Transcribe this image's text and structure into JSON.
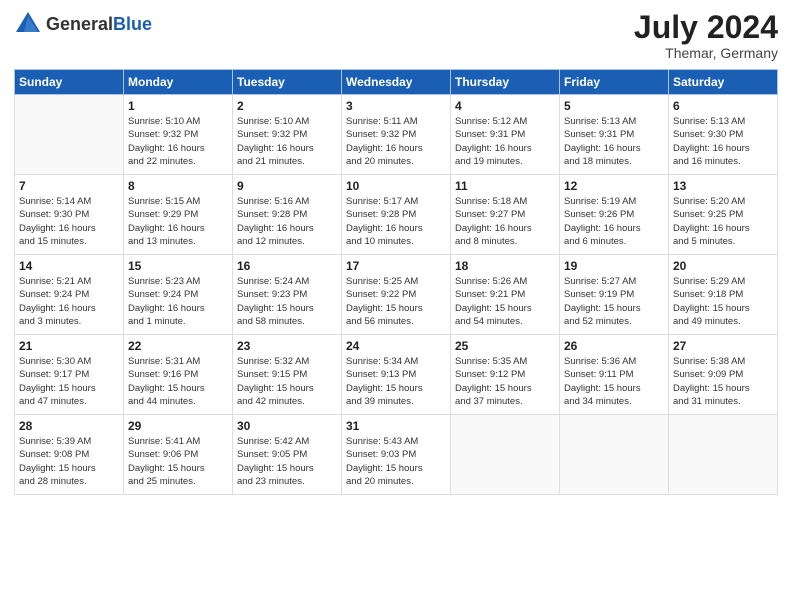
{
  "logo": {
    "general": "General",
    "blue": "Blue"
  },
  "title": {
    "month_year": "July 2024",
    "location": "Themar, Germany"
  },
  "header_days": [
    "Sunday",
    "Monday",
    "Tuesday",
    "Wednesday",
    "Thursday",
    "Friday",
    "Saturday"
  ],
  "weeks": [
    [
      {
        "day": "",
        "info": ""
      },
      {
        "day": "1",
        "info": "Sunrise: 5:10 AM\nSunset: 9:32 PM\nDaylight: 16 hours\nand 22 minutes."
      },
      {
        "day": "2",
        "info": "Sunrise: 5:10 AM\nSunset: 9:32 PM\nDaylight: 16 hours\nand 21 minutes."
      },
      {
        "day": "3",
        "info": "Sunrise: 5:11 AM\nSunset: 9:32 PM\nDaylight: 16 hours\nand 20 minutes."
      },
      {
        "day": "4",
        "info": "Sunrise: 5:12 AM\nSunset: 9:31 PM\nDaylight: 16 hours\nand 19 minutes."
      },
      {
        "day": "5",
        "info": "Sunrise: 5:13 AM\nSunset: 9:31 PM\nDaylight: 16 hours\nand 18 minutes."
      },
      {
        "day": "6",
        "info": "Sunrise: 5:13 AM\nSunset: 9:30 PM\nDaylight: 16 hours\nand 16 minutes."
      }
    ],
    [
      {
        "day": "7",
        "info": "Sunrise: 5:14 AM\nSunset: 9:30 PM\nDaylight: 16 hours\nand 15 minutes."
      },
      {
        "day": "8",
        "info": "Sunrise: 5:15 AM\nSunset: 9:29 PM\nDaylight: 16 hours\nand 13 minutes."
      },
      {
        "day": "9",
        "info": "Sunrise: 5:16 AM\nSunset: 9:28 PM\nDaylight: 16 hours\nand 12 minutes."
      },
      {
        "day": "10",
        "info": "Sunrise: 5:17 AM\nSunset: 9:28 PM\nDaylight: 16 hours\nand 10 minutes."
      },
      {
        "day": "11",
        "info": "Sunrise: 5:18 AM\nSunset: 9:27 PM\nDaylight: 16 hours\nand 8 minutes."
      },
      {
        "day": "12",
        "info": "Sunrise: 5:19 AM\nSunset: 9:26 PM\nDaylight: 16 hours\nand 6 minutes."
      },
      {
        "day": "13",
        "info": "Sunrise: 5:20 AM\nSunset: 9:25 PM\nDaylight: 16 hours\nand 5 minutes."
      }
    ],
    [
      {
        "day": "14",
        "info": "Sunrise: 5:21 AM\nSunset: 9:24 PM\nDaylight: 16 hours\nand 3 minutes."
      },
      {
        "day": "15",
        "info": "Sunrise: 5:23 AM\nSunset: 9:24 PM\nDaylight: 16 hours\nand 1 minute."
      },
      {
        "day": "16",
        "info": "Sunrise: 5:24 AM\nSunset: 9:23 PM\nDaylight: 15 hours\nand 58 minutes."
      },
      {
        "day": "17",
        "info": "Sunrise: 5:25 AM\nSunset: 9:22 PM\nDaylight: 15 hours\nand 56 minutes."
      },
      {
        "day": "18",
        "info": "Sunrise: 5:26 AM\nSunset: 9:21 PM\nDaylight: 15 hours\nand 54 minutes."
      },
      {
        "day": "19",
        "info": "Sunrise: 5:27 AM\nSunset: 9:19 PM\nDaylight: 15 hours\nand 52 minutes."
      },
      {
        "day": "20",
        "info": "Sunrise: 5:29 AM\nSunset: 9:18 PM\nDaylight: 15 hours\nand 49 minutes."
      }
    ],
    [
      {
        "day": "21",
        "info": "Sunrise: 5:30 AM\nSunset: 9:17 PM\nDaylight: 15 hours\nand 47 minutes."
      },
      {
        "day": "22",
        "info": "Sunrise: 5:31 AM\nSunset: 9:16 PM\nDaylight: 15 hours\nand 44 minutes."
      },
      {
        "day": "23",
        "info": "Sunrise: 5:32 AM\nSunset: 9:15 PM\nDaylight: 15 hours\nand 42 minutes."
      },
      {
        "day": "24",
        "info": "Sunrise: 5:34 AM\nSunset: 9:13 PM\nDaylight: 15 hours\nand 39 minutes."
      },
      {
        "day": "25",
        "info": "Sunrise: 5:35 AM\nSunset: 9:12 PM\nDaylight: 15 hours\nand 37 minutes."
      },
      {
        "day": "26",
        "info": "Sunrise: 5:36 AM\nSunset: 9:11 PM\nDaylight: 15 hours\nand 34 minutes."
      },
      {
        "day": "27",
        "info": "Sunrise: 5:38 AM\nSunset: 9:09 PM\nDaylight: 15 hours\nand 31 minutes."
      }
    ],
    [
      {
        "day": "28",
        "info": "Sunrise: 5:39 AM\nSunset: 9:08 PM\nDaylight: 15 hours\nand 28 minutes."
      },
      {
        "day": "29",
        "info": "Sunrise: 5:41 AM\nSunset: 9:06 PM\nDaylight: 15 hours\nand 25 minutes."
      },
      {
        "day": "30",
        "info": "Sunrise: 5:42 AM\nSunset: 9:05 PM\nDaylight: 15 hours\nand 23 minutes."
      },
      {
        "day": "31",
        "info": "Sunrise: 5:43 AM\nSunset: 9:03 PM\nDaylight: 15 hours\nand 20 minutes."
      },
      {
        "day": "",
        "info": ""
      },
      {
        "day": "",
        "info": ""
      },
      {
        "day": "",
        "info": ""
      }
    ]
  ]
}
